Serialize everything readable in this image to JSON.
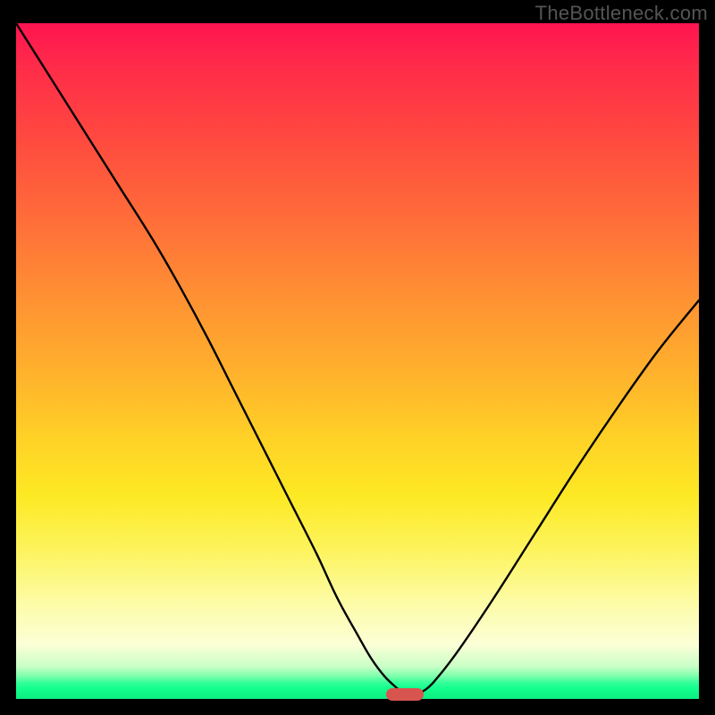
{
  "watermark": "TheBottleneck.com",
  "chart_data": {
    "type": "line",
    "title": "",
    "xlabel": "",
    "ylabel": "",
    "xlim": [
      0,
      100
    ],
    "ylim": [
      0,
      100
    ],
    "grid": false,
    "x": [
      0,
      5,
      10,
      15,
      20,
      24,
      28,
      32,
      36,
      40,
      44,
      47,
      50,
      52,
      54,
      56,
      57,
      58,
      60,
      62,
      65,
      70,
      76,
      82,
      88,
      94,
      100
    ],
    "values": [
      100,
      92,
      84,
      76,
      68,
      61,
      53.5,
      45.5,
      37.5,
      29.5,
      21.5,
      15,
      9.5,
      6,
      3.3,
      1.4,
      0.6,
      0.5,
      1.4,
      3.5,
      7.5,
      15,
      24.5,
      34,
      43,
      51.5,
      59
    ],
    "marker": {
      "x": 57,
      "y": 0.6,
      "color": "#d8554f"
    },
    "background_gradient": {
      "top": "#ff1450",
      "mid_orange": "#ff8f33",
      "mid_yellow": "#fde924",
      "pale": "#fbffd6",
      "green": "#13ff8e"
    }
  }
}
